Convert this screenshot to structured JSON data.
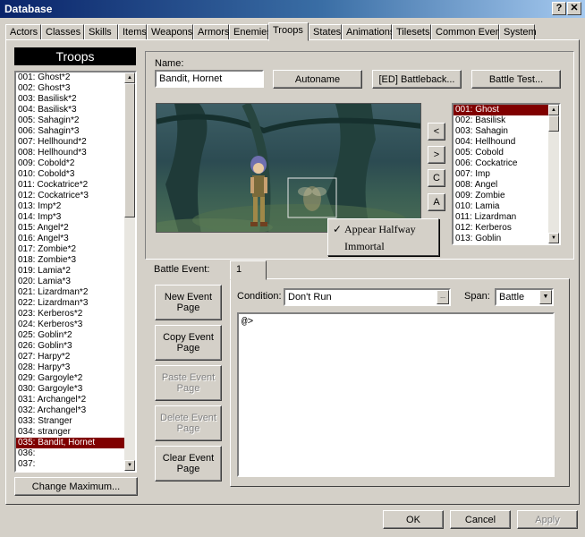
{
  "window": {
    "title": "Database",
    "help": "?",
    "close": "✕"
  },
  "tabs": [
    "Actors",
    "Classes",
    "Skills",
    "Items",
    "Weapons",
    "Armors",
    "Enemies",
    "Troops",
    "States",
    "Animations",
    "Tilesets",
    "Common Events",
    "System"
  ],
  "active_tab": "Troops",
  "troops": {
    "header": "Troops",
    "items": [
      "001: Ghost*2",
      "002: Ghost*3",
      "003: Basilisk*2",
      "004: Basilisk*3",
      "005: Sahagin*2",
      "006: Sahagin*3",
      "007: Hellhound*2",
      "008: Hellhound*3",
      "009: Cobold*2",
      "010: Cobold*3",
      "011: Cockatrice*2",
      "012: Cockatrice*3",
      "013: Imp*2",
      "014: Imp*3",
      "015: Angel*2",
      "016: Angel*3",
      "017: Zombie*2",
      "018: Zombie*3",
      "019: Lamia*2",
      "020: Lamia*3",
      "021: Lizardman*2",
      "022: Lizardman*3",
      "023: Kerberos*2",
      "024: Kerberos*3",
      "025: Goblin*2",
      "026: Goblin*3",
      "027: Harpy*2",
      "028: Harpy*3",
      "029: Gargoyle*2",
      "030: Gargoyle*3",
      "031: Archangel*2",
      "032: Archangel*3",
      "033: Stranger",
      "034: stranger",
      "035: Bandit, Hornet",
      "036:",
      "037:"
    ],
    "selected_index": 34,
    "change_max": "Change Maximum..."
  },
  "name_label": "Name:",
  "name_value": "Bandit, Hornet",
  "buttons": {
    "autoname": "Autoname",
    "battleback": "[ED] Battleback...",
    "battle_test": "Battle Test...",
    "add": "<",
    "remove": ">",
    "clear": "C",
    "arrange": "A",
    "new_event": "New Event Page",
    "copy_event": "Copy Event Page",
    "paste_event": "Paste Event Page",
    "delete_event": "Delete Event Page",
    "clear_event": "Clear Event Page",
    "ok": "OK",
    "cancel": "Cancel",
    "apply": "Apply"
  },
  "enemies": {
    "items": [
      "001: Ghost",
      "002: Basilisk",
      "003: Sahagin",
      "004: Hellhound",
      "005: Cobold",
      "006: Cockatrice",
      "007: Imp",
      "008: Angel",
      "009: Zombie",
      "010: Lamia",
      "011: Lizardman",
      "012: Kerberos",
      "013: Goblin"
    ],
    "selected_index": 0
  },
  "context_menu": {
    "items": [
      "Appear Halfway",
      "Immortal"
    ],
    "checked_index": 0,
    "check": "✓"
  },
  "battle_event": {
    "label": "Battle Event:",
    "page_tab": "1",
    "condition_label": "Condition:",
    "condition_value": "Don't Run",
    "condition_btn": "...",
    "span_label": "Span:",
    "span_value": "Battle",
    "content": "@>"
  },
  "scroll_up": "▲",
  "scroll_down": "▼"
}
